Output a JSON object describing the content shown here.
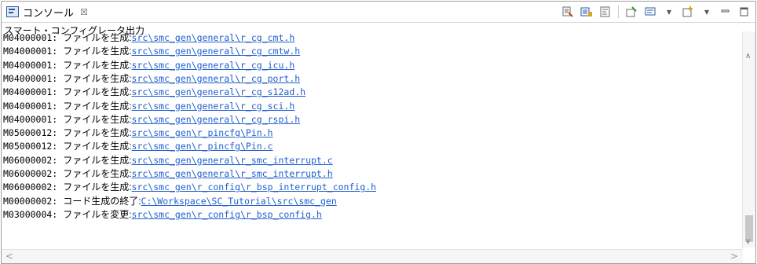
{
  "tab": {
    "title": "コンソール",
    "close_glyph": "☒"
  },
  "console": {
    "title": "スマート・コンフィグレータ出力"
  },
  "lines": [
    {
      "code": "M04000001:",
      "message": "ファイルを生成:",
      "path": "src\\smc_gen\\general\\r_cg_cmt.h"
    },
    {
      "code": "M04000001:",
      "message": "ファイルを生成:",
      "path": "src\\smc_gen\\general\\r_cg_cmtw.h"
    },
    {
      "code": "M04000001:",
      "message": "ファイルを生成:",
      "path": "src\\smc_gen\\general\\r_cg_icu.h"
    },
    {
      "code": "M04000001:",
      "message": "ファイルを生成:",
      "path": "src\\smc_gen\\general\\r_cg_port.h"
    },
    {
      "code": "M04000001:",
      "message": "ファイルを生成:",
      "path": "src\\smc_gen\\general\\r_cg_s12ad.h"
    },
    {
      "code": "M04000001:",
      "message": "ファイルを生成:",
      "path": "src\\smc_gen\\general\\r_cg_sci.h"
    },
    {
      "code": "M04000001:",
      "message": "ファイルを生成:",
      "path": "src\\smc_gen\\general\\r_cg_rspi.h"
    },
    {
      "code": "M05000012:",
      "message": "ファイルを生成:",
      "path": "src\\smc_gen\\r_pincfg\\Pin.h"
    },
    {
      "code": "M05000012:",
      "message": "ファイルを生成:",
      "path": "src\\smc_gen\\r_pincfg\\Pin.c"
    },
    {
      "code": "M06000002:",
      "message": "ファイルを生成:",
      "path": "src\\smc_gen\\general\\r_smc_interrupt.c"
    },
    {
      "code": "M06000002:",
      "message": "ファイルを生成:",
      "path": "src\\smc_gen\\general\\r_smc_interrupt.h"
    },
    {
      "code": "M06000002:",
      "message": "ファイルを生成:",
      "path": "src\\smc_gen\\r_config\\r_bsp_interrupt_config.h"
    },
    {
      "code": "M00000002:",
      "message": "コード生成の終了:",
      "path": "C:\\Workspace\\SC_Tutorial\\src\\smc_gen"
    },
    {
      "code": "M03000004:",
      "message": "ファイルを変更:",
      "path": "src\\smc_gen\\r_config\\r_bsp_config.h"
    }
  ],
  "toolbar_icons": [
    "clear-console-icon",
    "scroll-lock-icon",
    "word-wrap-icon",
    "pin-console-icon",
    "display-console-icon",
    "open-console-icon",
    "minimize-icon",
    "maximize-icon"
  ],
  "colors": {
    "link": "#1f5fcf",
    "border": "#a0a0a0"
  }
}
